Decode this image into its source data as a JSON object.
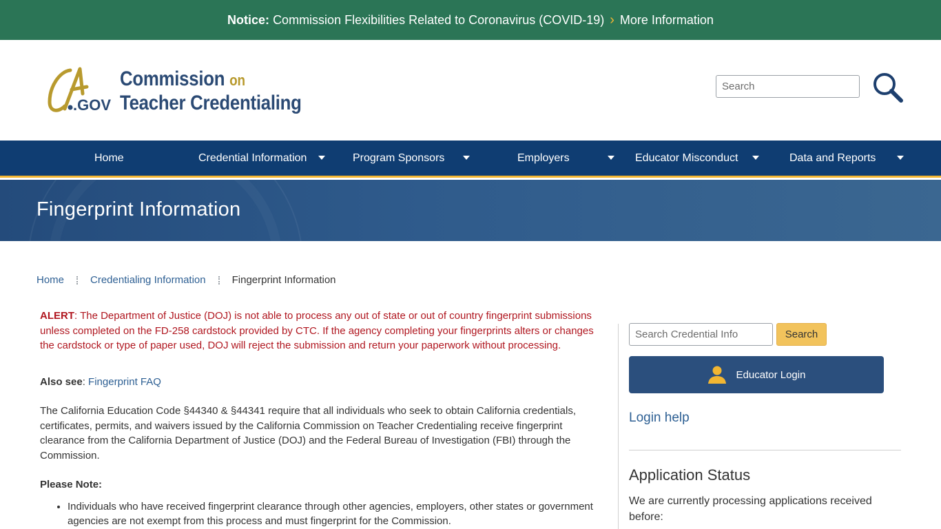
{
  "notice": {
    "label": "Notice:",
    "text": "Commission Flexibilities Related to Coronavirus (COVID-19)",
    "link": "More Information"
  },
  "header": {
    "logo_ca": "CA",
    "logo_gov": ".GOV",
    "logo_line1": "Commission",
    "logo_on": "on",
    "logo_line2": "Teacher Credentialing",
    "search_placeholder": "Search"
  },
  "nav": {
    "items": [
      {
        "label": "Home"
      },
      {
        "label": "Credential Information"
      },
      {
        "label": "Program Sponsors"
      },
      {
        "label": "Employers"
      },
      {
        "label": "Educator Misconduct"
      },
      {
        "label": "Data and Reports"
      }
    ]
  },
  "banner": {
    "title": "Fingerprint Information"
  },
  "breadcrumb": {
    "items": [
      "Home",
      "Credentialing Information",
      "Fingerprint Information"
    ]
  },
  "main": {
    "alert_label": "ALERT",
    "alert_text": ":  The Department of Justice (DOJ) is not able to process any out of state or out of country fingerprint submissions unless completed on the FD-258 cardstock provided by CTC.  If the agency completing your fingerprints alters or changes the cardstock or type of paper used, DOJ will reject the submission and return your paperwork without processing.",
    "also_label": "Also see",
    "also_sep": ":  ",
    "also_link": "Fingerprint FAQ",
    "para": "The California Education Code §44340 & §44341 require that all individuals who seek to obtain California credentials, certificates, permits, and waivers issued by the California Commission on Teacher Credentialing receive fingerprint clearance from the California Department of Justice (DOJ) and the Federal Bureau of Investigation (FBI) through the Commission.",
    "note_label": "Please Note:",
    "list": [
      "Individuals who have received fingerprint clearance through other agencies, employers, other states or government agencies  are not exempt  from this process and must fingerprint for the Commission."
    ]
  },
  "sidebar": {
    "search_placeholder": "Search Credential Info",
    "search_button": "Search",
    "login_button": "Educator Login",
    "login_help": "Login help",
    "app_status_title": "Application Status",
    "app_status_text": "We are currently processing applications received before:"
  },
  "colors": {
    "notice_bg": "#2b7556",
    "nav_bg": "#0f3d72",
    "accent_gold": "#f2b632",
    "link": "#2d5f93",
    "alert": "#b0161f",
    "login_bg": "#2b4f7d"
  }
}
